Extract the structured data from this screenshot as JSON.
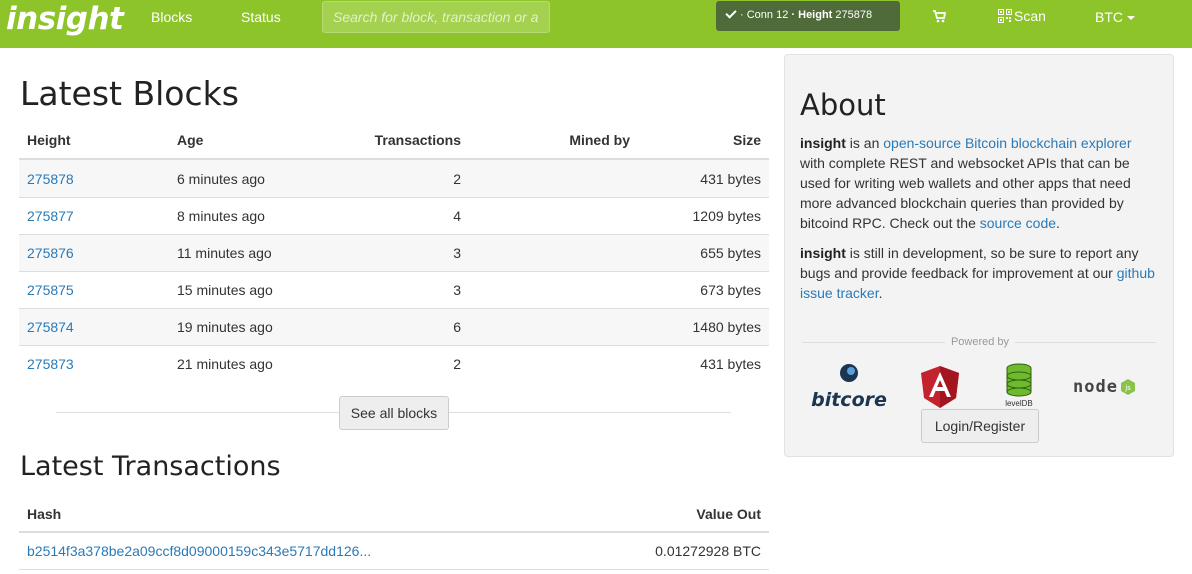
{
  "navbar": {
    "brand": "insight",
    "links": [
      "Blocks",
      "Status"
    ],
    "search_placeholder": "Search for block, transaction or a",
    "status": {
      "conn_label": "· Conn",
      "conn": "12",
      "height_label": "· Height",
      "height": "275878"
    },
    "scan_label": "Scan",
    "currency": "BTC",
    "icons": [
      "check-icon",
      "cart-icon",
      "qr-icon",
      "caret-down-icon"
    ]
  },
  "blocks": {
    "title": "Latest Blocks",
    "headers": {
      "height": "Height",
      "age": "Age",
      "transactions": "Transactions",
      "mined_by": "Mined by",
      "size": "Size"
    },
    "rows": [
      {
        "height": "275878",
        "age": "6 minutes ago",
        "transactions": "2",
        "mined_by": "",
        "size": "431 bytes"
      },
      {
        "height": "275877",
        "age": "8 minutes ago",
        "transactions": "4",
        "mined_by": "",
        "size": "1209 bytes"
      },
      {
        "height": "275876",
        "age": "11 minutes ago",
        "transactions": "3",
        "mined_by": "",
        "size": "655 bytes"
      },
      {
        "height": "275875",
        "age": "15 minutes ago",
        "transactions": "3",
        "mined_by": "",
        "size": "673 bytes"
      },
      {
        "height": "275874",
        "age": "19 minutes ago",
        "transactions": "6",
        "mined_by": "",
        "size": "1480 bytes"
      },
      {
        "height": "275873",
        "age": "21 minutes ago",
        "transactions": "2",
        "mined_by": "",
        "size": "431 bytes"
      }
    ],
    "see_all_label": "See all blocks"
  },
  "transactions": {
    "title": "Latest Transactions",
    "headers": {
      "hash": "Hash",
      "value_out": "Value Out"
    },
    "rows": [
      {
        "hash": "b2514f3a378be2a09ccf8d09000159c343e5717dd126...",
        "value_out": "0.01272928 BTC"
      }
    ]
  },
  "about": {
    "title": "About",
    "p1": {
      "brand": "insight",
      "text1": " is an ",
      "link1": "open-source Bitcoin blockchain explorer",
      "text2": " with complete REST and websocket APIs that can be used for writing web wallets and other apps that need more advanced blockchain queries than provided by bitcoind RPC. Check out the ",
      "link2": "source code",
      "text3": "."
    },
    "p2": {
      "brand": "insight",
      "text1": " is still in development, so be sure to report any bugs and provide feedback for improvement at our ",
      "link1": "github issue tracker",
      "text2": "."
    },
    "powered_by": "Powered by",
    "logos": {
      "bitcore": "bitcore",
      "leveldb": "levelDB",
      "node": "node"
    },
    "login_label": "Login/Register"
  },
  "colors": {
    "navbar": "#8dc429",
    "link": "#2a7ab7",
    "status_pill": "#4f6b3a"
  }
}
